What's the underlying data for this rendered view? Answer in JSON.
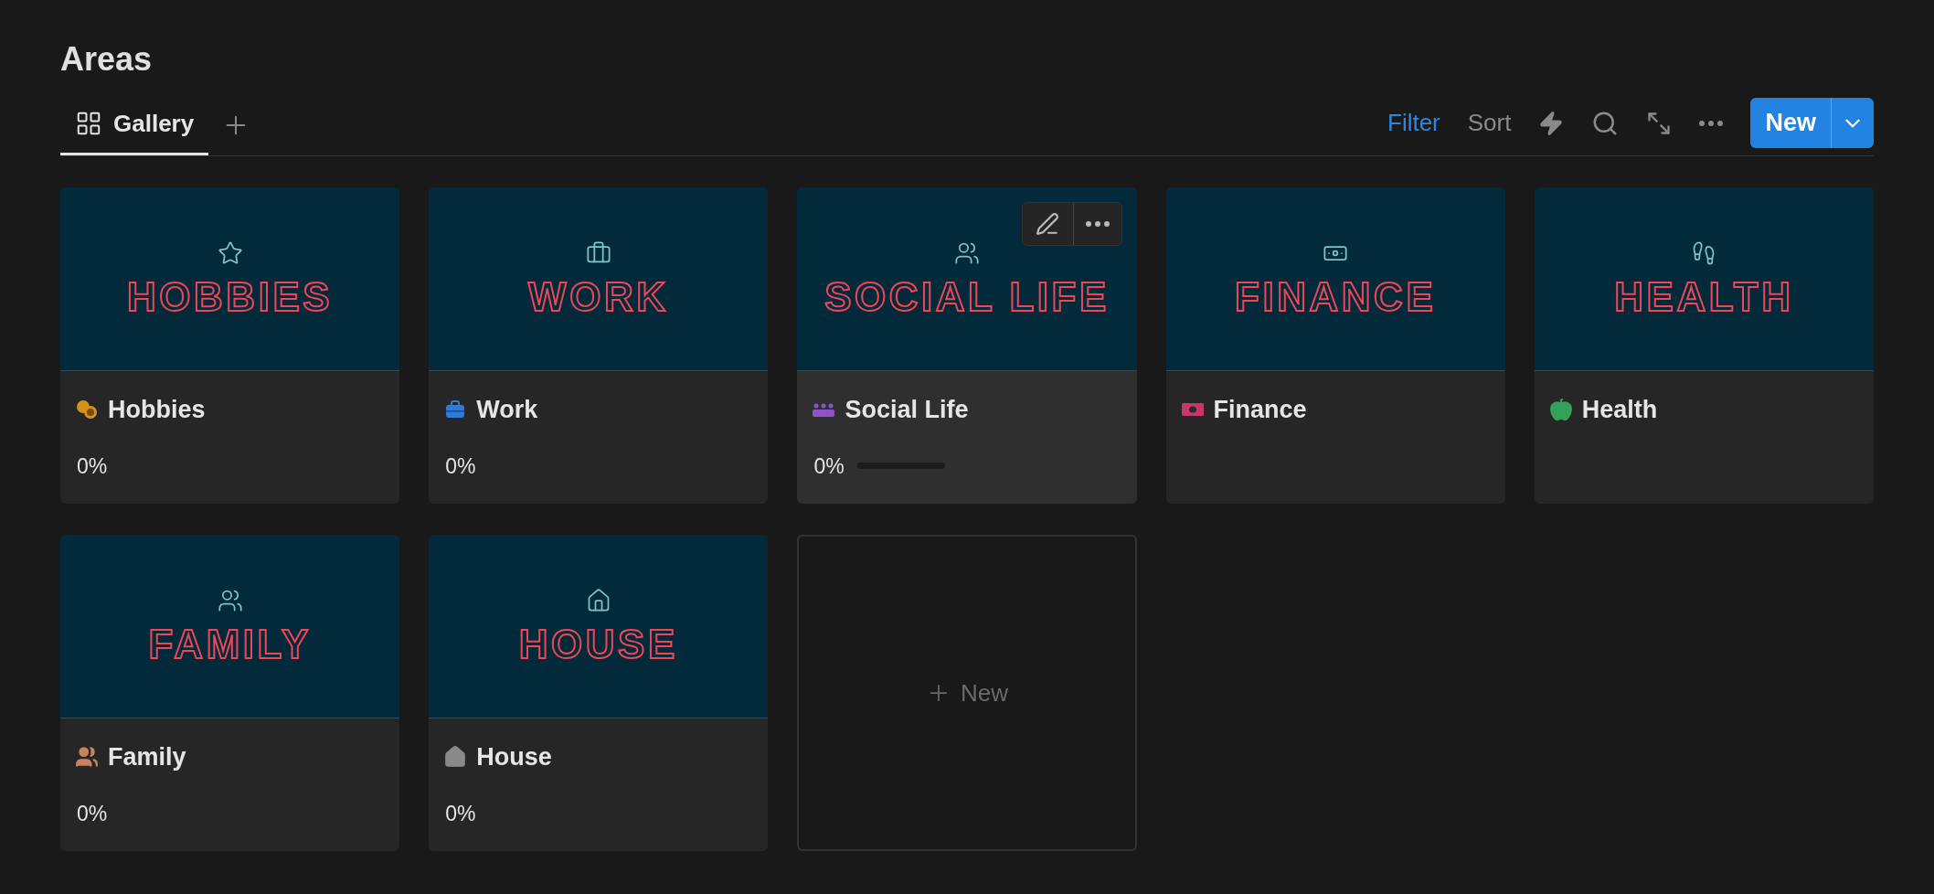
{
  "page": {
    "title": "Areas"
  },
  "tabs": [
    {
      "label": "Gallery",
      "selected": true
    }
  ],
  "toolbar": {
    "filter": "Filter",
    "sort": "Sort",
    "new_button": "New"
  },
  "cards": [
    {
      "cover_title": "HOBBIES",
      "title": "Hobbies",
      "hovered": false,
      "progress": {
        "reading": "0%"
      }
    },
    {
      "cover_title": "WORK",
      "title": "Work",
      "hovered": false,
      "progress": {
        "reading": "0%"
      }
    },
    {
      "cover_title": "SOCIAL LIFE",
      "title": "Social Life",
      "hovered": true,
      "progress": {
        "reading": "0%"
      }
    },
    {
      "cover_title": "FINANCE",
      "title": "Finance",
      "hovered": false
    },
    {
      "cover_title": "HEALTH",
      "title": "Health",
      "hovered": false
    },
    {
      "cover_title": "FAMILY",
      "title": "Family",
      "hovered": false,
      "progress": {
        "reading": "0%"
      }
    },
    {
      "cover_title": "HOUSE",
      "title": "House",
      "hovered": false,
      "progress": {
        "reading": "0%"
      }
    }
  ],
  "new_card": {
    "label": "New"
  }
}
